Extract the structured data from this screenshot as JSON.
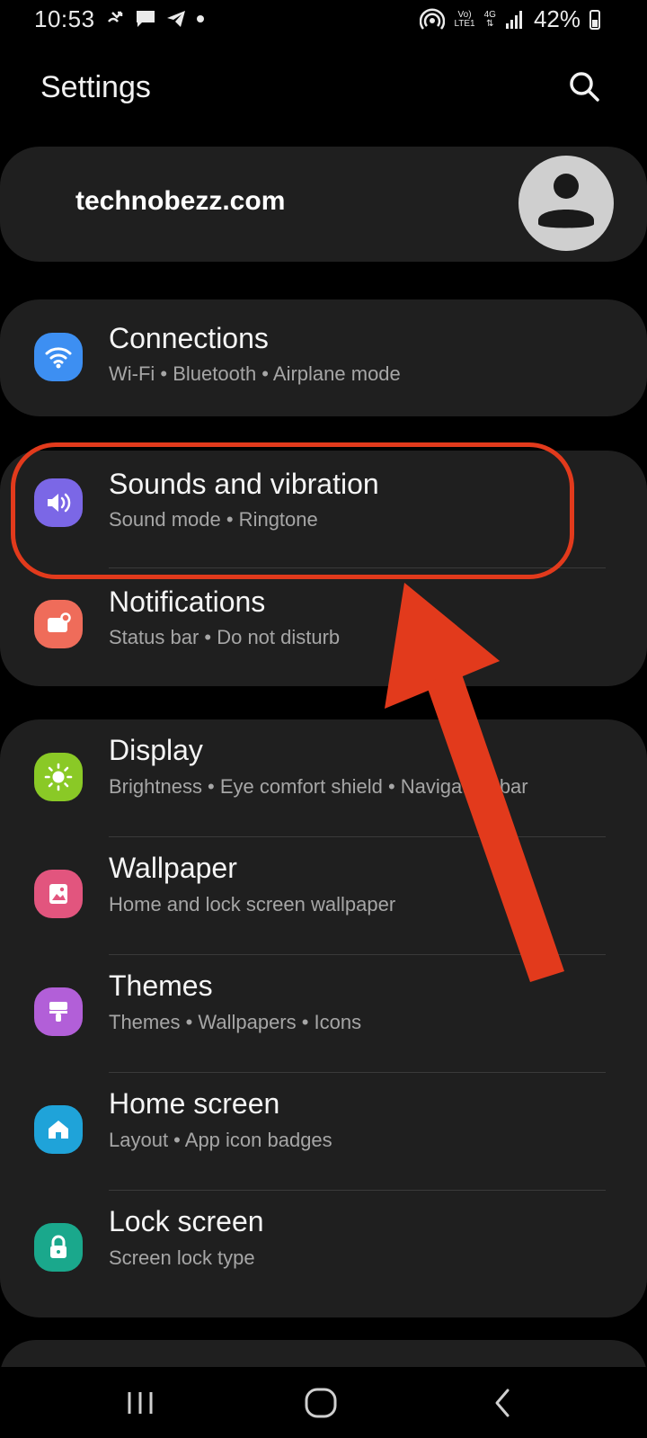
{
  "status_bar": {
    "time": "10:53",
    "battery": "42%",
    "net_top": "Vo)",
    "net_bottom": "LTE1",
    "gen_top": "4G",
    "icons": [
      "missed-call-icon",
      "message-icon",
      "telegram-icon",
      "dot-icon",
      "hotspot-icon",
      "signal-icon",
      "battery-icon"
    ]
  },
  "header": {
    "title": "Settings",
    "search_icon": "search-icon"
  },
  "account": {
    "name": "technobezz.com",
    "avatar_icon": "person-icon"
  },
  "items": [
    {
      "title": "Connections",
      "subtitle": "Wi-Fi  •  Bluetooth  •  Airplane mode",
      "icon": "wifi-icon",
      "color": "#3d8ff2"
    },
    {
      "title": "Sounds and vibration",
      "subtitle": "Sound mode  •  Ringtone",
      "icon": "volume-icon",
      "color": "#7b67e6"
    },
    {
      "title": "Notifications",
      "subtitle": "Status bar  •  Do not disturb",
      "icon": "notification-icon",
      "color": "#ef6c5a"
    },
    {
      "title": "Display",
      "subtitle": "Brightness  •  Eye comfort shield  •  Navigation bar",
      "icon": "sun-icon",
      "color": "#8ac926"
    },
    {
      "title": "Wallpaper",
      "subtitle": "Home and lock screen wallpaper",
      "icon": "image-icon",
      "color": "#e2557e"
    },
    {
      "title": "Themes",
      "subtitle": "Themes  •  Wallpapers  •  Icons",
      "icon": "brush-icon",
      "color": "#b25fd8"
    },
    {
      "title": "Home screen",
      "subtitle": "Layout  •  App icon badges",
      "icon": "home-icon",
      "color": "#1fa3d9"
    },
    {
      "title": "Lock screen",
      "subtitle": "Screen lock type",
      "icon": "lock-icon",
      "color": "#1aa88c"
    }
  ],
  "nav": {
    "recents_icon": "recents-icon",
    "home_icon": "home-circle-icon",
    "back_icon": "back-icon"
  },
  "annotation_color": "#e23a1c"
}
